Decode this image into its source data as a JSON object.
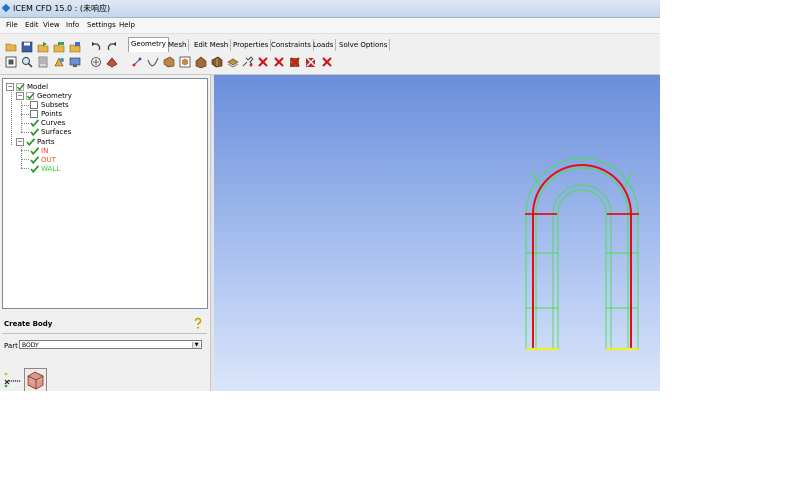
{
  "window": {
    "title": "ICEM CFD 15.0 : (未响应)"
  },
  "menu": [
    "File",
    "Edit",
    "View",
    "Info",
    "Settings",
    "Help"
  ],
  "tabs": [
    {
      "label": "Geometry",
      "active": true
    },
    {
      "label": "Mesh",
      "active": false
    },
    {
      "label": "Edit Mesh",
      "active": false
    },
    {
      "label": "Properties",
      "active": false
    },
    {
      "label": "Constraints",
      "active": false
    },
    {
      "label": "Loads",
      "active": false
    },
    {
      "label": "Solve Options",
      "active": false
    }
  ],
  "tree": {
    "root": "Model",
    "geometry": {
      "label": "Geometry",
      "children": [
        {
          "label": "Subsets",
          "checked": false
        },
        {
          "label": "Points",
          "checked": false
        },
        {
          "label": "Curves",
          "checked": true
        },
        {
          "label": "Surfaces",
          "checked": true
        }
      ]
    },
    "parts": {
      "label": "Parts",
      "children": [
        {
          "label": "IN",
          "checked": true,
          "color": "#ff3333"
        },
        {
          "label": "OUT",
          "checked": true,
          "color": "#e06010"
        },
        {
          "label": "WALL",
          "checked": true,
          "color": "#33cc33"
        }
      ]
    }
  },
  "body_panel": {
    "title": "Create Body",
    "part_label": "Part",
    "part_value": "BODY"
  },
  "colors": {
    "curve_red": "#e01010",
    "surface_green": "#46e046",
    "inlet_yellow": "#f0f020",
    "viewport_top": "#6a8edb"
  }
}
